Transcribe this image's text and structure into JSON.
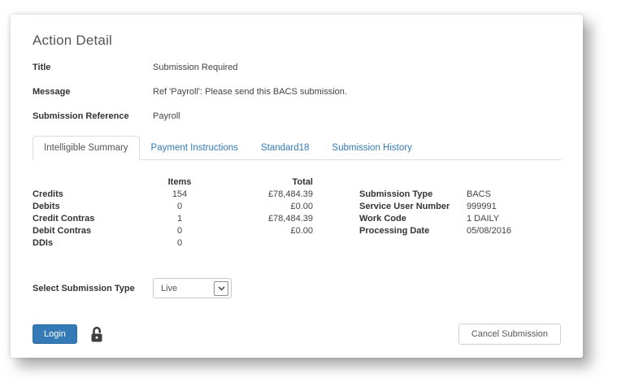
{
  "page": {
    "title": "Action Detail"
  },
  "fields": [
    {
      "label": "Title",
      "value": "Submission Required"
    },
    {
      "label": "Message",
      "value": "Ref 'Payroll': Please send this BACS submission."
    },
    {
      "label": "Submission Reference",
      "value": "Payroll"
    }
  ],
  "tabs": [
    {
      "label": "Intelligible Summary",
      "active": true
    },
    {
      "label": "Payment Instructions",
      "active": false
    },
    {
      "label": "Standard18",
      "active": false
    },
    {
      "label": "Submission History",
      "active": false
    }
  ],
  "summary_table": {
    "headers": {
      "items": "Items",
      "total": "Total"
    },
    "rows": [
      {
        "label": "Credits",
        "items": "154",
        "total": "£78,484.39"
      },
      {
        "label": "Debits",
        "items": "0",
        "total": "£0.00"
      },
      {
        "label": "Credit Contras",
        "items": "1",
        "total": "£78,484.39"
      },
      {
        "label": "Debit Contras",
        "items": "0",
        "total": "£0.00"
      },
      {
        "label": "DDIs",
        "items": "0",
        "total": ""
      }
    ]
  },
  "details": [
    {
      "label": "Submission Type",
      "value": "BACS"
    },
    {
      "label": "Service User Number",
      "value": "999991"
    },
    {
      "label": "Work Code",
      "value": "1 DAILY"
    },
    {
      "label": "Processing Date",
      "value": "05/08/2016"
    }
  ],
  "submission_select": {
    "label": "Select Submission Type",
    "selected": "Live"
  },
  "actions": {
    "login_label": "Login",
    "cancel_label": "Cancel Submission",
    "lock_state": "unlocked"
  },
  "colors": {
    "accent_blue": "#337ab7",
    "tab_border": "#dddddd",
    "label_text": "#333333",
    "heading_text": "#565656"
  }
}
